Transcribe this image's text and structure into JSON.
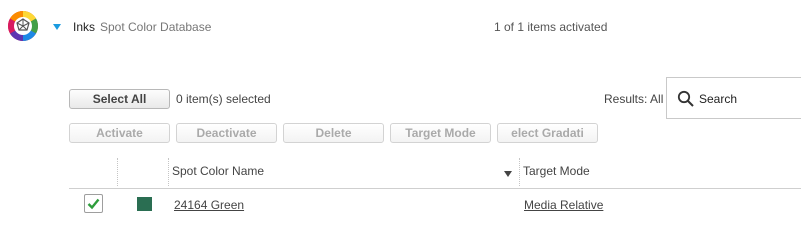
{
  "header": {
    "logo_icon": "color-wheel-icon",
    "expander_icon": "triangle-down-icon",
    "title": "Inks",
    "subtitle": "Spot Color Database",
    "status": "1 of 1 items activated"
  },
  "toolbar": {
    "select_all_label": "Select All",
    "selected_count": "0 item(s) selected",
    "results_label": "Results: All",
    "search_placeholder": "Search",
    "search_icon": "search-icon",
    "actions": {
      "activate": "Activate",
      "deactivate": "Deactivate",
      "delete": "Delete",
      "target_mode": "Target Mode",
      "select_gradation": "elect Gradati"
    }
  },
  "table": {
    "columns": {
      "spot_color_name": "Spot Color Name",
      "target_mode": "Target Mode"
    },
    "rows": [
      {
        "checked": true,
        "swatch_color": "#2a6e52",
        "name": "24164 Green",
        "target_mode": "Media Relative"
      }
    ]
  },
  "colors": {
    "accent": "#1a9be0",
    "check_green": "#2e9d3c"
  }
}
